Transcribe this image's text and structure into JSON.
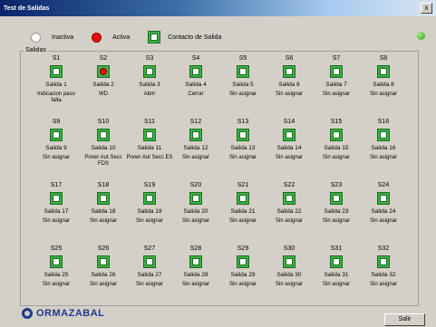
{
  "window": {
    "title": "Test de Salidas",
    "close_label": "x"
  },
  "legend": {
    "inactive": "Inactiva",
    "active": "Activa",
    "contact": "Contacto de Salida"
  },
  "group_label": "Salidas",
  "outputs": [
    {
      "id": "S1",
      "name": "Salida 1",
      "desc": "Indicacion paso falta",
      "active": false
    },
    {
      "id": "S2",
      "name": "Salida 2",
      "desc": "WD",
      "active": true
    },
    {
      "id": "S3",
      "name": "Salida 3",
      "desc": "Abrir",
      "active": false
    },
    {
      "id": "S4",
      "name": "Salida 4",
      "desc": "Cerrar",
      "active": false
    },
    {
      "id": "S5",
      "name": "Salida 5",
      "desc": "Sin asignar",
      "active": false
    },
    {
      "id": "S6",
      "name": "Salida 6",
      "desc": "Sin asignar",
      "active": false
    },
    {
      "id": "S7",
      "name": "Salida 7",
      "desc": "Sin asignar",
      "active": false
    },
    {
      "id": "S8",
      "name": "Salida 8",
      "desc": "Sin asignar",
      "active": false
    },
    {
      "id": "S9",
      "name": "Salida 9",
      "desc": "Sin asignar",
      "active": false
    },
    {
      "id": "S10",
      "name": "Salida 10",
      "desc": "Poner Aut Secc FDS",
      "active": false
    },
    {
      "id": "S11",
      "name": "Salida 11",
      "desc": "Poner Aut Secc ES",
      "active": false
    },
    {
      "id": "S12",
      "name": "Salida 12",
      "desc": "Sin asignar",
      "active": false
    },
    {
      "id": "S13",
      "name": "Salida 13",
      "desc": "Sin asignar",
      "active": false
    },
    {
      "id": "S14",
      "name": "Salida 14",
      "desc": "Sin asignar",
      "active": false
    },
    {
      "id": "S15",
      "name": "Salida 15",
      "desc": "Sin asignar",
      "active": false
    },
    {
      "id": "S16",
      "name": "Salida 16",
      "desc": "Sin asignar",
      "active": false
    },
    {
      "id": "S17",
      "name": "Salida 17",
      "desc": "Sin asignar",
      "active": false
    },
    {
      "id": "S18",
      "name": "Salida 18",
      "desc": "Sin asignar",
      "active": false
    },
    {
      "id": "S19",
      "name": "Salida 19",
      "desc": "Sin asignar",
      "active": false
    },
    {
      "id": "S20",
      "name": "Salida 20",
      "desc": "Sin asignar",
      "active": false
    },
    {
      "id": "S21",
      "name": "Salida 21",
      "desc": "Sin asignar",
      "active": false
    },
    {
      "id": "S22",
      "name": "Salida 22",
      "desc": "Sin asignar",
      "active": false
    },
    {
      "id": "S23",
      "name": "Salida 23",
      "desc": "Sin asignar",
      "active": false
    },
    {
      "id": "S24",
      "name": "Salida 24",
      "desc": "Sin asignar",
      "active": false
    },
    {
      "id": "S25",
      "name": "Salida 25",
      "desc": "Sin asignar",
      "active": false
    },
    {
      "id": "S26",
      "name": "Salida 26",
      "desc": "Sin asignar",
      "active": false
    },
    {
      "id": "S27",
      "name": "Salida 27",
      "desc": "Sin asignar",
      "active": false
    },
    {
      "id": "S28",
      "name": "Salida 28",
      "desc": "Sin asignar",
      "active": false
    },
    {
      "id": "S29",
      "name": "Salida 29",
      "desc": "Sin asignar",
      "active": false
    },
    {
      "id": "S30",
      "name": "Salida 30",
      "desc": "Sin asignar",
      "active": false
    },
    {
      "id": "S31",
      "name": "Salida 31",
      "desc": "Sin asignar",
      "active": false
    },
    {
      "id": "S32",
      "name": "Salida 32",
      "desc": "Sin asignar",
      "active": false
    }
  ],
  "footer": {
    "logo_text": "ORMAZABAL",
    "exit_label": "Salir"
  },
  "colors": {
    "contact_green": "#3db045",
    "active_red": "#e01010",
    "status_led": "#28a020"
  }
}
